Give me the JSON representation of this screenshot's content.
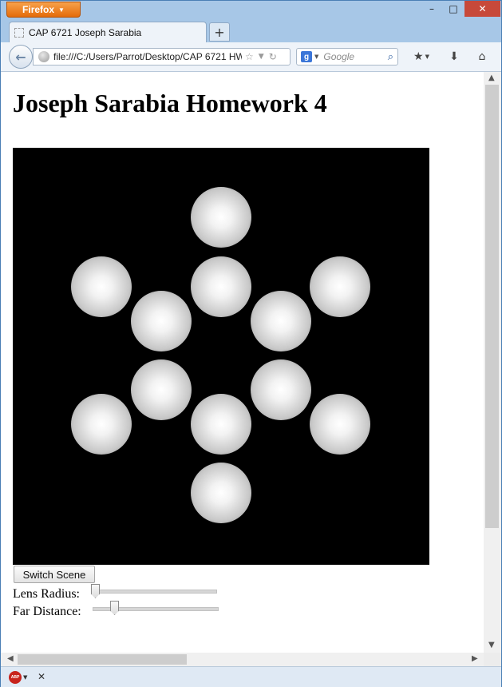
{
  "browser": {
    "menu_button": "Firefox",
    "window_controls": {
      "minimize": "–",
      "maximize": "□",
      "close": "✕"
    },
    "tab": {
      "title": "CAP 6721 Joseph Sarabia"
    },
    "new_tab": "+",
    "url": "file:///C:/Users/Parrot/Desktop/CAP 6721 HW",
    "search_placeholder": "Google"
  },
  "page": {
    "heading": "Joseph Sarabia Homework 4",
    "switch_button": "Switch Scene",
    "sliders": [
      {
        "label": "Lens Radius:",
        "value": 0.0
      },
      {
        "label": "Far Distance:",
        "value": 0.15
      }
    ]
  },
  "addon_bar": {
    "abp_label": "ABP"
  }
}
